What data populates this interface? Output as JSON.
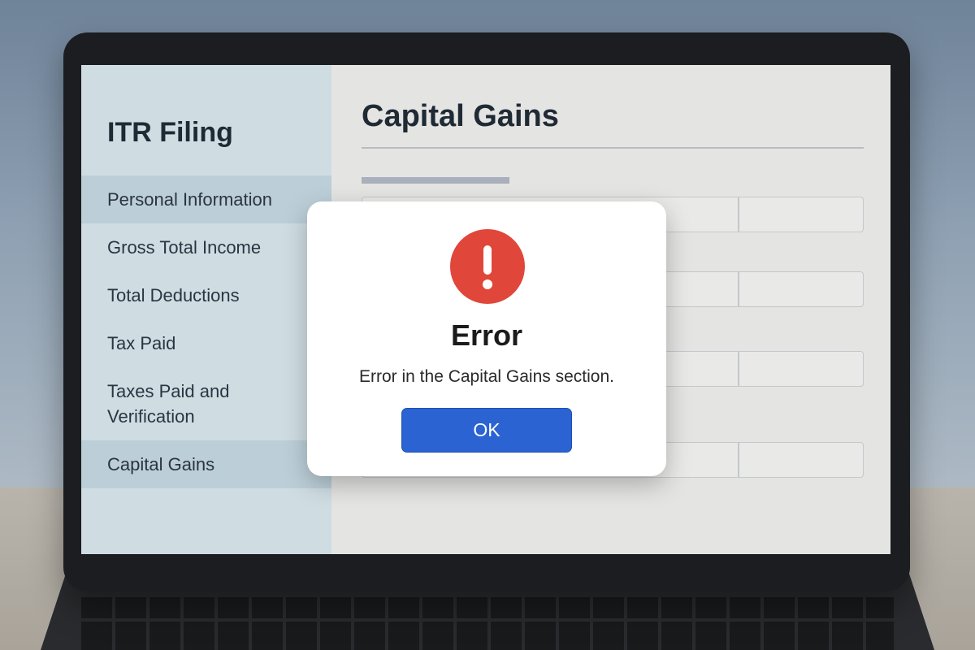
{
  "sidebar": {
    "title": "ITR Filing",
    "items": [
      {
        "label": "Personal Information"
      },
      {
        "label": "Gross Total Income"
      },
      {
        "label": "Total Deductions"
      },
      {
        "label": "Tax Paid"
      },
      {
        "label": "Taxes Paid and Verification"
      },
      {
        "label": "Capital Gains"
      }
    ],
    "active_item": "Capital Gains"
  },
  "main": {
    "title": "Capital Gains"
  },
  "dialog": {
    "icon": "exclamation-alert-icon",
    "title": "Error",
    "message": "Error in the Capital Gains section.",
    "ok_label": "OK"
  },
  "colors": {
    "alert": "#e0473a",
    "button": "#2b63d3",
    "sidebar": "#cfdde3"
  }
}
